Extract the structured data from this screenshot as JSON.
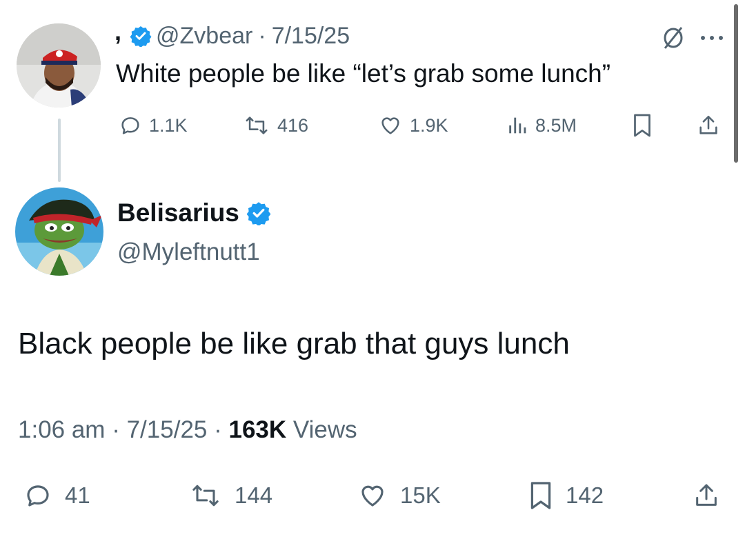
{
  "parent_tweet": {
    "display_name": ",",
    "handle": "@Zvbear",
    "date": "7/15/25",
    "text": "White people be like “let’s grab some lunch”",
    "stats": {
      "replies": "1.1K",
      "reposts": "416",
      "likes": "1.9K",
      "views": "8.5M"
    },
    "icons": [
      "grok-icon",
      "more-icon",
      "reply-icon",
      "repost-icon",
      "like-icon",
      "views-icon",
      "bookmark-icon",
      "share-icon"
    ]
  },
  "main_tweet": {
    "display_name": "Belisarius",
    "handle": "@Myleftnutt1",
    "text": "Black people be like grab that guys lunch",
    "time": "1:06 am",
    "date": "7/15/25",
    "views_count": "163K",
    "views_label": "Views",
    "stats": {
      "replies": "41",
      "reposts": "144",
      "likes": "15K",
      "bookmarks": "142"
    }
  },
  "colors": {
    "verified": "#1d9bf0",
    "muted": "#536471",
    "text": "#0f1419",
    "thread_line": "#cfd9de"
  }
}
